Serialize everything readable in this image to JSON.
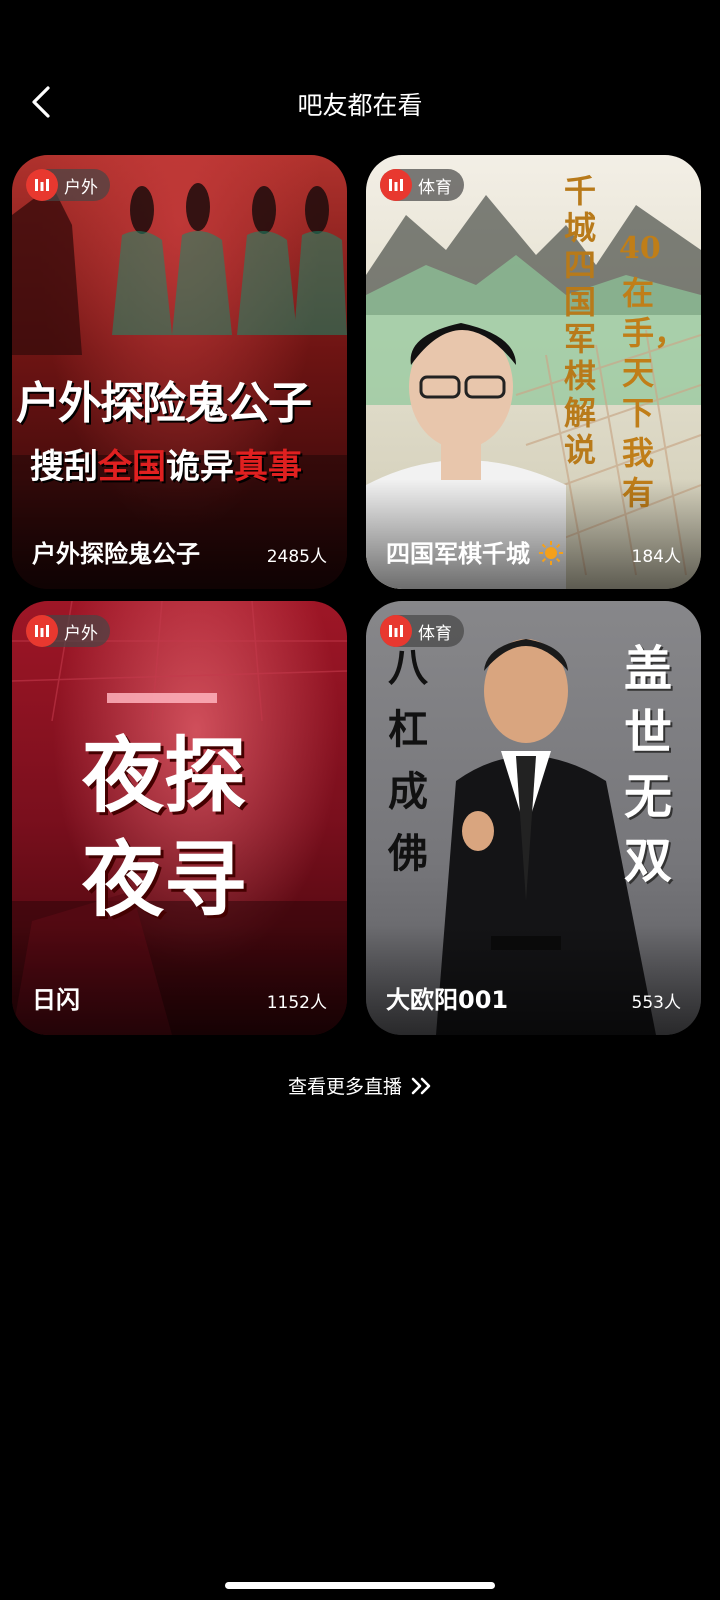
{
  "header": {
    "title": "吧友都在看"
  },
  "cards": [
    {
      "category": "户外",
      "name": "户外探险鬼公子",
      "viewers": "2485人",
      "poster_text": {
        "line1": "户外探险鬼公子",
        "line2_parts": [
          "搜刮",
          "全国",
          "诡异",
          "真事"
        ]
      }
    },
    {
      "category": "体育",
      "name": "四国军棋千城",
      "viewers": "184人",
      "poster_text": {
        "vertical1": "千城四国军棋解说",
        "vertical2a": "40",
        "vertical2b": "在手，天下我有"
      }
    },
    {
      "category": "户外",
      "name": "日闪",
      "viewers": "1152人",
      "poster_text": {
        "line1": "夜探",
        "line2": "夜寻"
      }
    },
    {
      "category": "体育",
      "name": "大欧阳001",
      "viewers": "553人",
      "poster_text": {
        "left": "八杠成佛",
        "right": "盖世无双"
      }
    }
  ],
  "more": {
    "label": "查看更多直播"
  },
  "colors": {
    "accent": "#e8382f",
    "background": "#000000"
  }
}
